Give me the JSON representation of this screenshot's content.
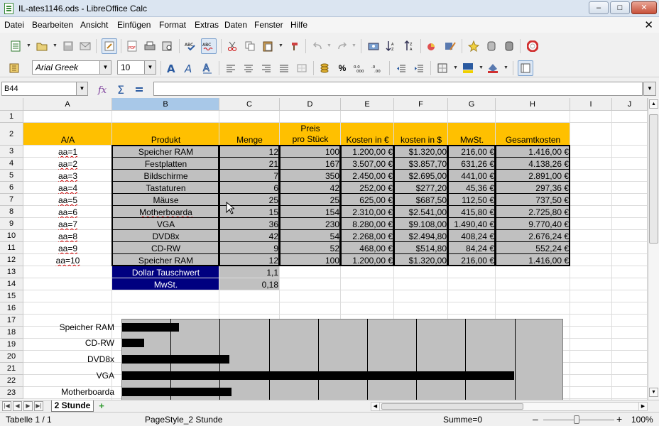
{
  "window": {
    "title": "IL-ates1146.ods - LibreOffice Calc",
    "minimize": "–",
    "maximize": "□",
    "close": "✕"
  },
  "menu": [
    "Datei",
    "Bearbeiten",
    "Ansicht",
    "Einfügen",
    "Format",
    "Extras",
    "Daten",
    "Fenster",
    "Hilfe"
  ],
  "menu_close": "✕",
  "font": {
    "name": "Arial Greek",
    "size": "10"
  },
  "formula": {
    "cell_ref": "B44",
    "content": ""
  },
  "columns": [
    "A",
    "B",
    "C",
    "D",
    "E",
    "F",
    "G",
    "H",
    "I",
    "J"
  ],
  "selected_column": "B",
  "rows": [
    "1",
    "2",
    "3",
    "4",
    "5",
    "6",
    "7",
    "8",
    "9",
    "10",
    "11",
    "12",
    "13",
    "14",
    "15",
    "16",
    "17",
    "18",
    "19",
    "20",
    "21",
    "22",
    "23"
  ],
  "table": {
    "headers": {
      "aa": "A/A",
      "produkt": "Produkt",
      "menge": "Menge",
      "preis_line1": "Preis",
      "preis_line2": "pro Stück",
      "kosten_eur": "Kosten in €",
      "kosten_usd": "kosten in $",
      "mwst": "MwSt.",
      "gesamt": "Gesamtkosten"
    },
    "rows": [
      [
        "aa=1",
        "Speicher RAM",
        "12",
        "100",
        "1.200,00 €",
        "$1.320,00",
        "216,00 €",
        "1.416,00 €"
      ],
      [
        "aa=2",
        "Festplatten",
        "21",
        "167",
        "3.507,00 €",
        "$3.857,70",
        "631,26 €",
        "4.138,26 €"
      ],
      [
        "aa=3",
        "Bildschirme",
        "7",
        "350",
        "2.450,00 €",
        "$2.695,00",
        "441,00 €",
        "2.891,00 €"
      ],
      [
        "aa=4",
        "Tastaturen",
        "6",
        "42",
        "252,00 €",
        "$277,20",
        "45,36 €",
        "297,36 €"
      ],
      [
        "aa=5",
        "Mäuse",
        "25",
        "25",
        "625,00 €",
        "$687,50",
        "112,50 €",
        "737,50 €"
      ],
      [
        "aa=6",
        "Motherboarda",
        "15",
        "154",
        "2.310,00 €",
        "$2.541,00",
        "415,80 €",
        "2.725,80 €"
      ],
      [
        "aa=7",
        "VGA",
        "36",
        "230",
        "8.280,00 €",
        "$9.108,00",
        "1.490,40 €",
        "9.770,40 €"
      ],
      [
        "aa=8",
        "DVD8x",
        "42",
        "54",
        "2.268,00 €",
        "$2.494,80",
        "408,24 €",
        "2.676,24 €"
      ],
      [
        "aa=9",
        "CD-RW",
        "9",
        "52",
        "468,00 €",
        "$514,80",
        "84,24 €",
        "552,24 €"
      ],
      [
        "aa=10",
        "Speicher RAM",
        "12",
        "100",
        "1.200,00 €",
        "$1.320,00",
        "216,00 €",
        "1.416,00 €"
      ]
    ]
  },
  "params": [
    {
      "label": "Dollar Tauschwert",
      "value": "1,1"
    },
    {
      "label": "MwSt.",
      "value": "0,18"
    }
  ],
  "chart_data": {
    "type": "bar",
    "orientation": "horizontal",
    "categories": [
      "Speicher RAM",
      "CD-RW",
      "DVD8x",
      "VGA",
      "Motherboarda"
    ],
    "values": [
      1200,
      468,
      2268,
      8280,
      2310
    ],
    "xlim": [
      0,
      9000
    ],
    "grid": true,
    "bar_color": "#000000",
    "background": "#c0c0c0"
  },
  "sheet": {
    "tab": "2 Stunde",
    "add": "+"
  },
  "status": {
    "sheet": "Tabelle 1 / 1",
    "page_style": "PageStyle_2 Stunde",
    "sum": "Summe=0",
    "zoom": "100%"
  },
  "colors": {
    "header_fill": "#ffc000",
    "table_fill": "#c0c0c0",
    "param_label_fill": "#000080",
    "selection": "#a8c8e8"
  }
}
